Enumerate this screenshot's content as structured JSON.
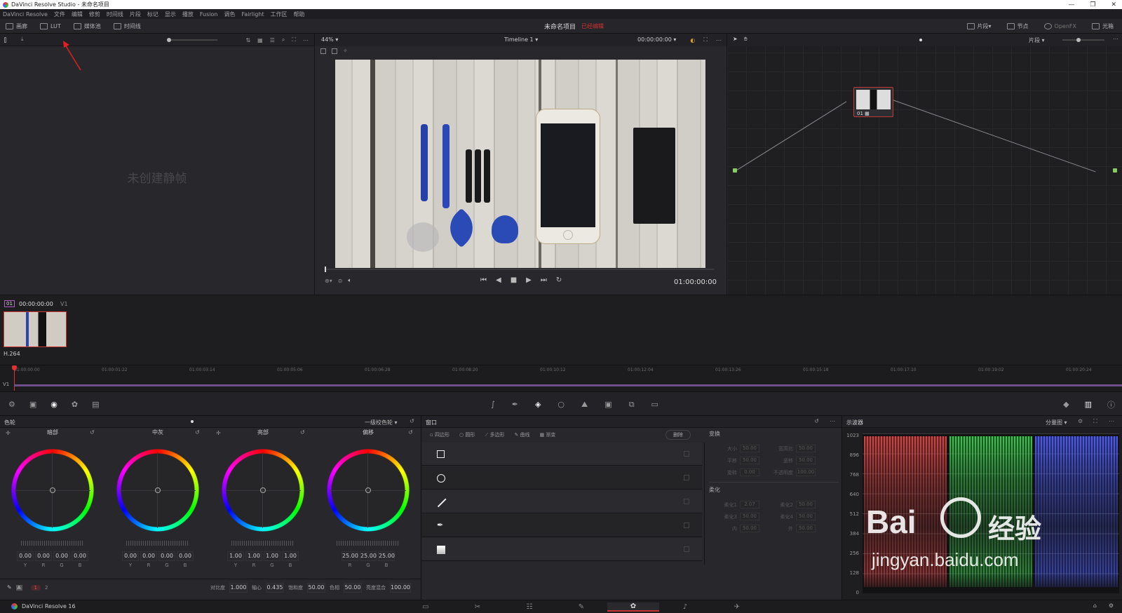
{
  "window": {
    "title": "DaVinci Resolve Studio - 未命名项目",
    "controls": [
      "—",
      "❐",
      "✕"
    ]
  },
  "menu": [
    "DaVinci Resolve",
    "文件",
    "编辑",
    "修剪",
    "时间线",
    "片段",
    "标记",
    "显示",
    "播放",
    "Fusion",
    "调色",
    "Fairlight",
    "工作区",
    "帮助"
  ],
  "toolbar": {
    "left": [
      "画廊",
      "LUT",
      "媒体池",
      "时间线"
    ],
    "project_name": "未命名项目",
    "project_status": "已经编辑",
    "right": [
      "片段",
      "节点",
      "OpenFX",
      "光箱"
    ]
  },
  "gallery": {
    "empty_text": "未创建静帧"
  },
  "viewer": {
    "zoom": "44%",
    "timeline_name": "Timeline 1",
    "timecode_top": "00:00:00:00",
    "timecode": "01:00:00:00",
    "scrub_progress": 0.0
  },
  "node_editor": {
    "mode": "片段",
    "node_label": "01"
  },
  "clips": {
    "clip_index": "01",
    "clip_timecode": "00:00:00:00",
    "track": "V1",
    "codec": "H.264"
  },
  "mini_timeline": {
    "track_label": "V1",
    "ticks": [
      "01:00:00:00",
      "01:00:01:22",
      "01:00:03:14",
      "01:00:05:06",
      "01:00:06:28",
      "01:00:08:20",
      "01:00:10:12",
      "01:00:12:04",
      "01:00:13:26",
      "01:00:15:18",
      "01:00:17:10",
      "01:00:19:02",
      "01:00:20:24"
    ]
  },
  "color_wheels": {
    "title": "色轮",
    "mode": "一级校色轮",
    "wheels": [
      {
        "name": "暗部",
        "values": [
          "0.00",
          "0.00",
          "0.00",
          "0.00"
        ],
        "labels": [
          "Y",
          "R",
          "G",
          "B"
        ]
      },
      {
        "name": "中灰",
        "values": [
          "0.00",
          "0.00",
          "0.00",
          "0.00"
        ],
        "labels": [
          "Y",
          "R",
          "G",
          "B"
        ]
      },
      {
        "name": "亮部",
        "values": [
          "1.00",
          "1.00",
          "1.00",
          "1.00"
        ],
        "labels": [
          "Y",
          "R",
          "G",
          "B"
        ]
      },
      {
        "name": "偏移",
        "values": [
          "25.00",
          "25.00",
          "25.00"
        ],
        "labels": [
          "R",
          "G",
          "B"
        ]
      }
    ],
    "bottom": {
      "pages": [
        "1",
        "2"
      ],
      "params": [
        {
          "label": "对比度",
          "value": "1.000"
        },
        {
          "label": "轴心",
          "value": "0.435"
        },
        {
          "label": "饱和度",
          "value": "50.00"
        },
        {
          "label": "色相",
          "value": "50.00"
        },
        {
          "label": "亮度混合",
          "value": "100.00"
        }
      ]
    }
  },
  "window_panel": {
    "title": "窗口",
    "tools": [
      "四边形",
      "圆形",
      "多边形",
      "曲线",
      "渐变"
    ],
    "delete_label": "删除",
    "transform": {
      "title": "变换",
      "rows": [
        [
          {
            "label": "大小",
            "value": "50.00"
          },
          {
            "label": "宽高比",
            "value": "50.00"
          }
        ],
        [
          {
            "label": "平移",
            "value": "50.00"
          },
          {
            "label": "竖移",
            "value": "50.00"
          }
        ],
        [
          {
            "label": "旋转",
            "value": "0.00"
          },
          {
            "label": "不透明度",
            "value": "100.00"
          }
        ]
      ]
    },
    "softness": {
      "title": "柔化",
      "rows": [
        [
          {
            "label": "柔化1",
            "value": "2.07"
          },
          {
            "label": "柔化2",
            "value": "50.00"
          }
        ],
        [
          {
            "label": "柔化3",
            "value": "50.00"
          },
          {
            "label": "柔化4",
            "value": "50.00"
          }
        ],
        [
          {
            "label": "内",
            "value": "50.00"
          },
          {
            "label": "外",
            "value": "50.00"
          }
        ]
      ]
    }
  },
  "scopes": {
    "title": "示波器",
    "mode": "分量图",
    "y_labels": [
      "1023",
      "896",
      "768",
      "640",
      "512",
      "384",
      "256",
      "128",
      "0"
    ],
    "colors": {
      "r": "#e04848",
      "g": "#40d050",
      "b": "#5060ff"
    }
  },
  "footer": {
    "app": "DaVinci Resolve 16"
  },
  "watermark": {
    "brand": "Bai",
    "cn": "经验",
    "url": "jingyan.baidu.com"
  },
  "annotation_color": "#e02020"
}
